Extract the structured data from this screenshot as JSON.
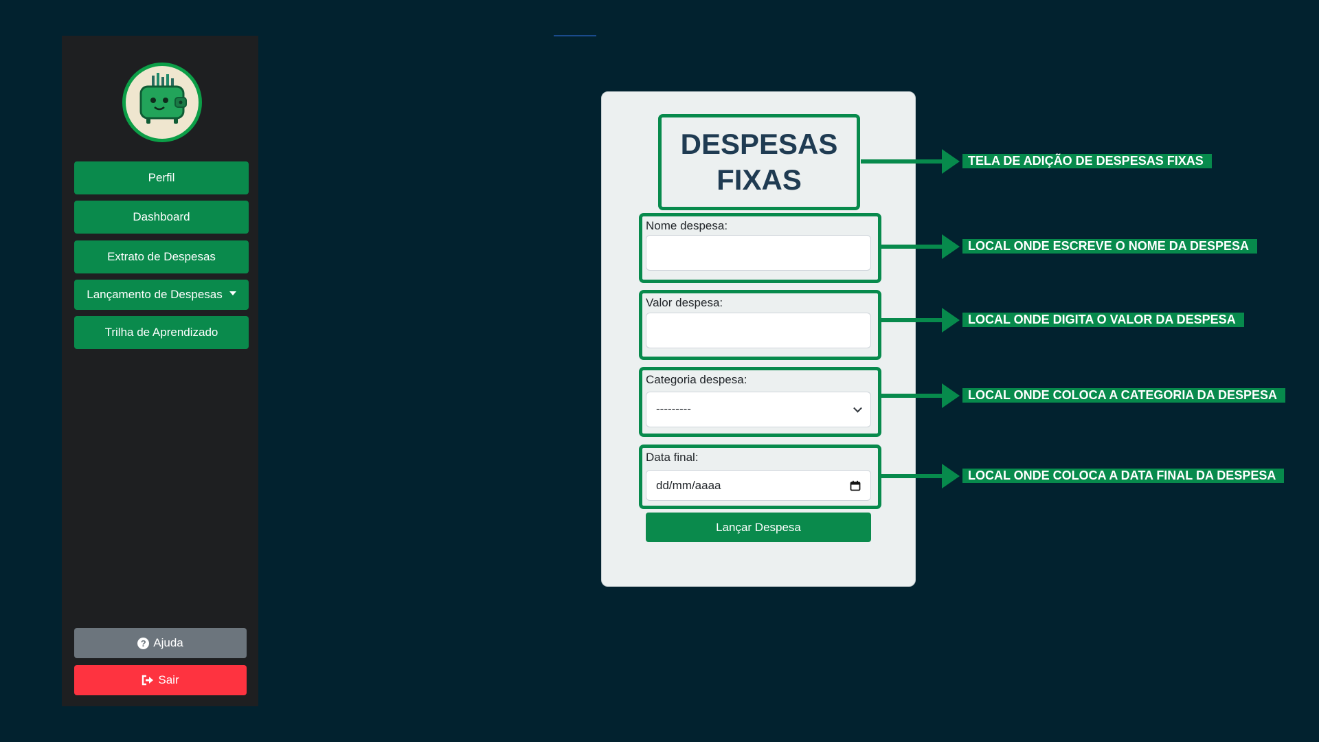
{
  "sidebar": {
    "logo_icon": "wallet-mascot-icon",
    "items": [
      {
        "label": "Perfil"
      },
      {
        "label": "Dashboard"
      },
      {
        "label": "Extrato de Despesas"
      },
      {
        "label": "Lançamento de Despesas"
      },
      {
        "label": "Trilha de Aprendizado"
      }
    ],
    "help_label": "Ajuda",
    "exit_label": "Sair"
  },
  "form": {
    "title_line1": "DESPESAS",
    "title_line2": "FIXAS",
    "name_label": "Nome despesa:",
    "value_label": "Valor despesa:",
    "category_label": "Categoria despesa:",
    "category_selected": "---------",
    "date_label": "Data final:",
    "date_placeholder": "dd/mm/aaaa",
    "submit_label": "Lançar Despesa"
  },
  "annotations": [
    "TELA DE ADIÇÃO DE DESPESAS FIXAS",
    "LOCAL ONDE ESCREVE O NOME DA DESPESA",
    "LOCAL ONDE DIGITA O VALOR DA DESPESA",
    "LOCAL ONDE COLOCA A CATEGORIA DA DESPESA",
    "LOCAL ONDE COLOCA A DATA FINAL DA DESPESA"
  ],
  "colors": {
    "background": "#02222f",
    "sidebar": "#1e1f21",
    "primary_green": "#0a8a4c",
    "help_gray": "#6c757d",
    "exit_red": "#fe3340",
    "title_text": "#1f3b52"
  }
}
